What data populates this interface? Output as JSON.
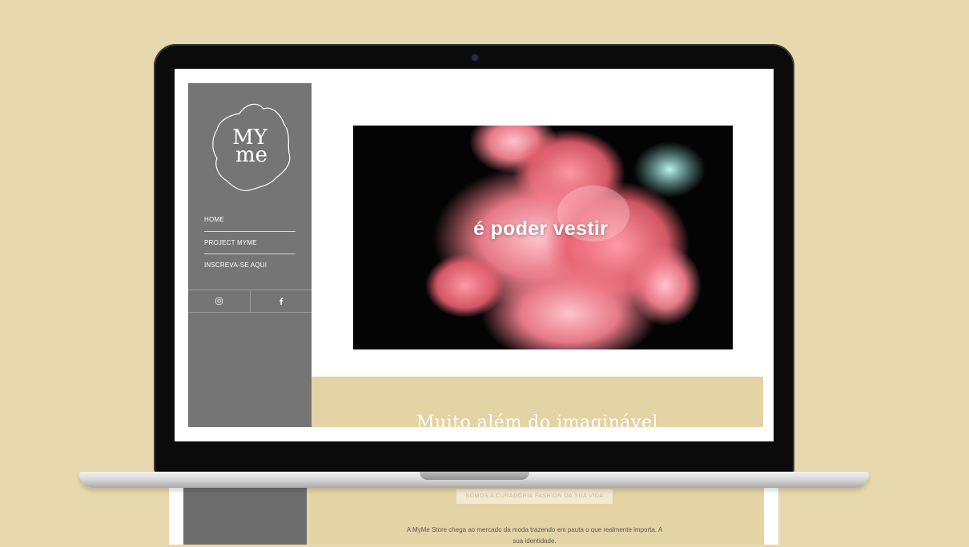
{
  "sidebar": {
    "logo_text_top": "MY",
    "logo_text_bottom": "me",
    "nav": [
      {
        "label": "HOME"
      },
      {
        "label": "PROJECT MYME"
      },
      {
        "label": "INSCREVA-SE AQUI"
      }
    ],
    "social": [
      {
        "icon": "instagram-icon"
      },
      {
        "icon": "facebook-icon"
      }
    ]
  },
  "hero": {
    "caption": "é poder vestir"
  },
  "section": {
    "title": "Muito além do imaginável",
    "tagline": "SOMOS A CURADORIA FASHION DA SUA VIDA",
    "body": "A MyMe Store chega ao mercado da moda trazendo em pauta o que realmente importa. A sua identidade."
  },
  "colors": {
    "background": "#e8d8ad",
    "sidebar": "#757575",
    "beige": "#e3d3a5"
  }
}
